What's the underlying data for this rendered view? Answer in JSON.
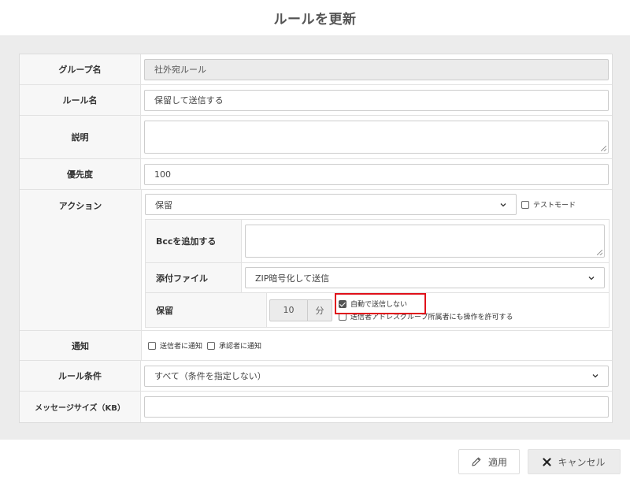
{
  "dialog": {
    "title": "ルールを更新"
  },
  "fields": {
    "group_name": {
      "label": "グループ名",
      "value": "社外宛ルール"
    },
    "rule_name": {
      "label": "ルール名",
      "value": "保留して送信する"
    },
    "description": {
      "label": "説明",
      "value": ""
    },
    "priority": {
      "label": "優先度",
      "value": "100"
    },
    "action": {
      "label": "アクション",
      "selected": "保留",
      "test_mode_label": "テストモード",
      "test_mode_checked": false,
      "bcc": {
        "label": "Bccを追加する",
        "value": ""
      },
      "attachment": {
        "label": "添付ファイル",
        "selected": "ZIP暗号化して送信"
      },
      "hold": {
        "label": "保留",
        "minutes": "10",
        "unit": "分",
        "auto_send_label": "自動で送信しない",
        "auto_send_checked": true,
        "allow_sender_label": "送信者アドレスグループ所属者にも操作を許可する",
        "allow_sender_checked": false
      }
    },
    "notify": {
      "label": "通知",
      "sender_label": "送信者に通知",
      "sender_checked": false,
      "approver_label": "承認者に通知",
      "approver_checked": false
    },
    "rule_condition": {
      "label": "ルール条件",
      "selected": "すべて（条件を指定しない）"
    },
    "message_size": {
      "label": "メッセージサイズ（KB）",
      "value": ""
    }
  },
  "footer": {
    "apply_label": "適用",
    "cancel_label": "キャンセル"
  },
  "highlight_color": "#e0101a"
}
